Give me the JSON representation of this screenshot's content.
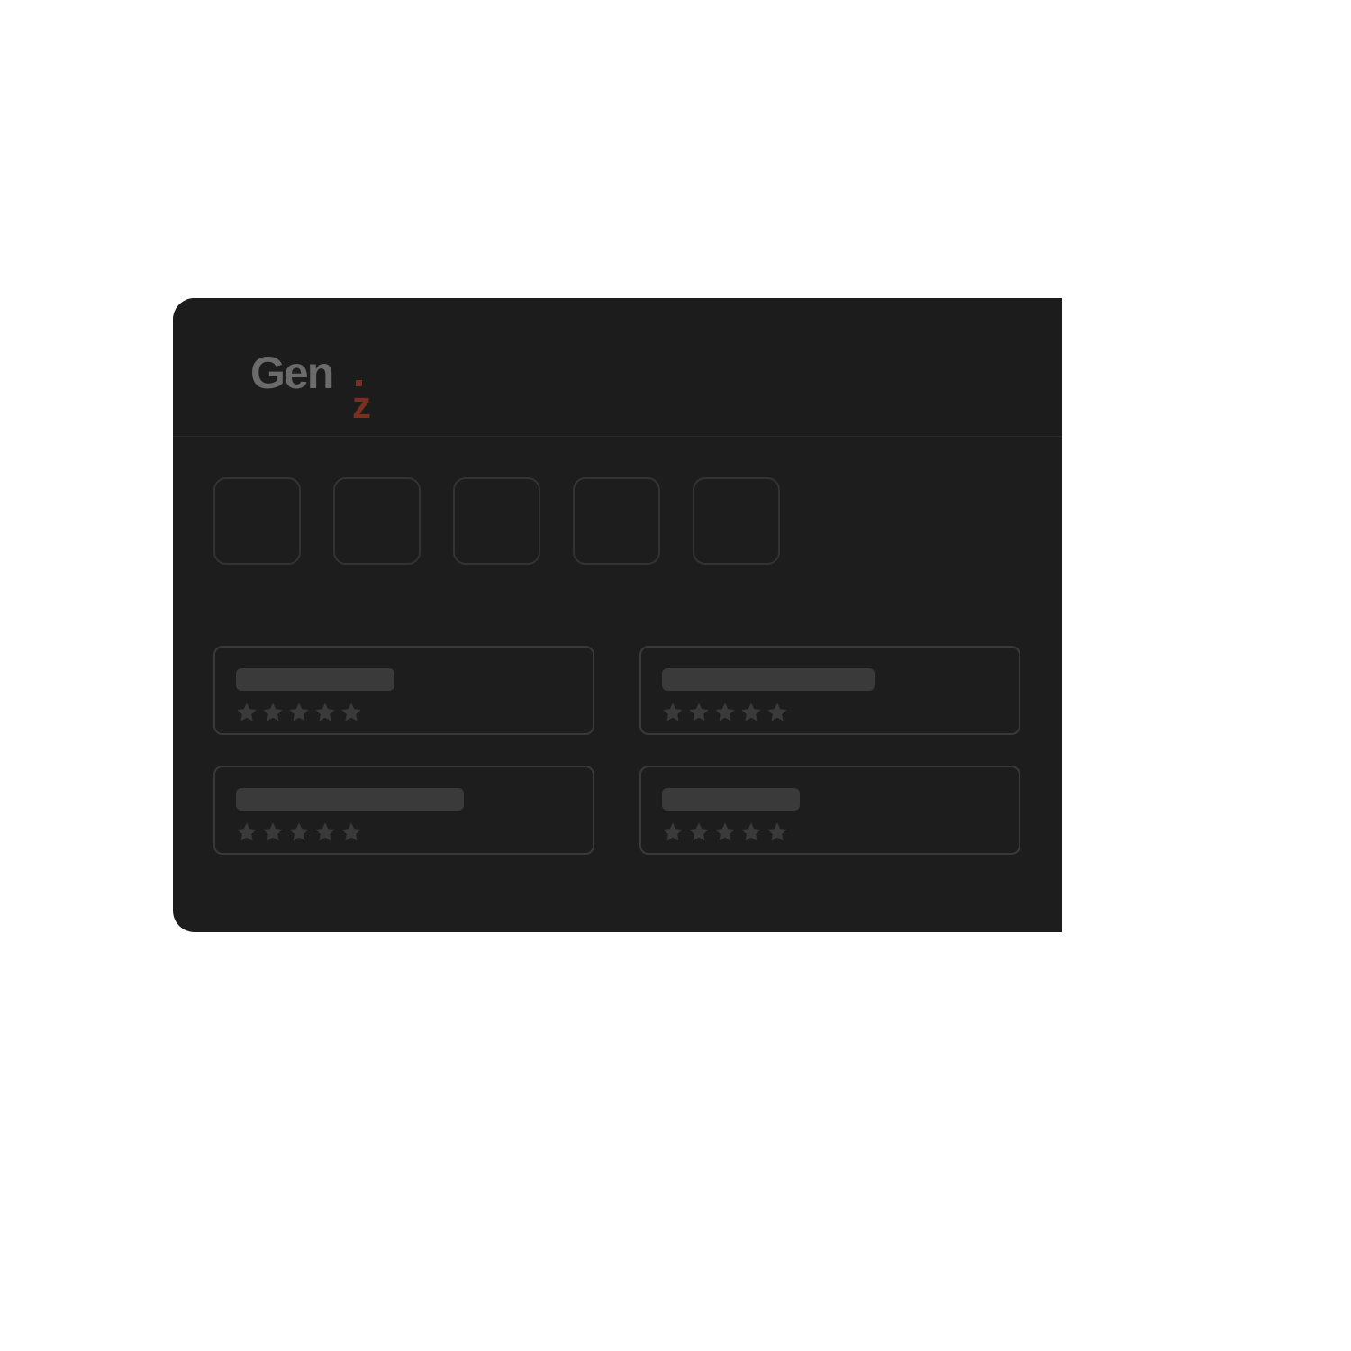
{
  "logo": {
    "text": "Gen",
    "accent": "z",
    "text_color": "#6b6b6b",
    "accent_color": "#7a2f1f"
  },
  "colors": {
    "background": "#1d1d1d",
    "placeholder": "#3a3a3a",
    "star": "#3a3a3a",
    "border": "#393939"
  },
  "tiles": [
    {
      "icon": "empty-tile"
    },
    {
      "icon": "empty-tile"
    },
    {
      "icon": "empty-tile"
    },
    {
      "icon": "empty-tile"
    },
    {
      "icon": "empty-tile"
    }
  ],
  "cards": [
    {
      "title": "",
      "rating": 5,
      "rating_max": 5
    },
    {
      "title": "",
      "rating": 5,
      "rating_max": 5
    },
    {
      "title": "",
      "rating": 5,
      "rating_max": 5
    },
    {
      "title": "",
      "rating": 5,
      "rating_max": 5
    }
  ]
}
